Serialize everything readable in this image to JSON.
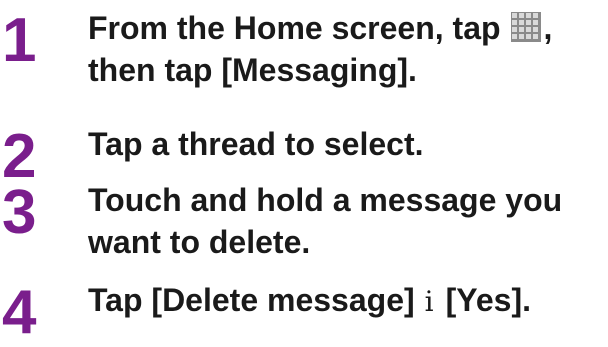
{
  "steps": [
    {
      "number": "1",
      "line1_before_icon": "From the Home screen, tap ",
      "line1_after_icon": ",",
      "line2": "then tap [Messaging].",
      "icon": "apps-grid-icon"
    },
    {
      "number": "2",
      "line1": "Tap a thread to select."
    },
    {
      "number": "3",
      "line1": "Touch and hold a message you",
      "line2": "want to delete."
    },
    {
      "number": "4",
      "line1_before_sep": "Tap [Delete message]",
      "separator": "i",
      "line1_after_sep": "[Yes]."
    }
  ],
  "colors": {
    "step_number": "#7a1e8c",
    "text": "#1a1a1a"
  }
}
